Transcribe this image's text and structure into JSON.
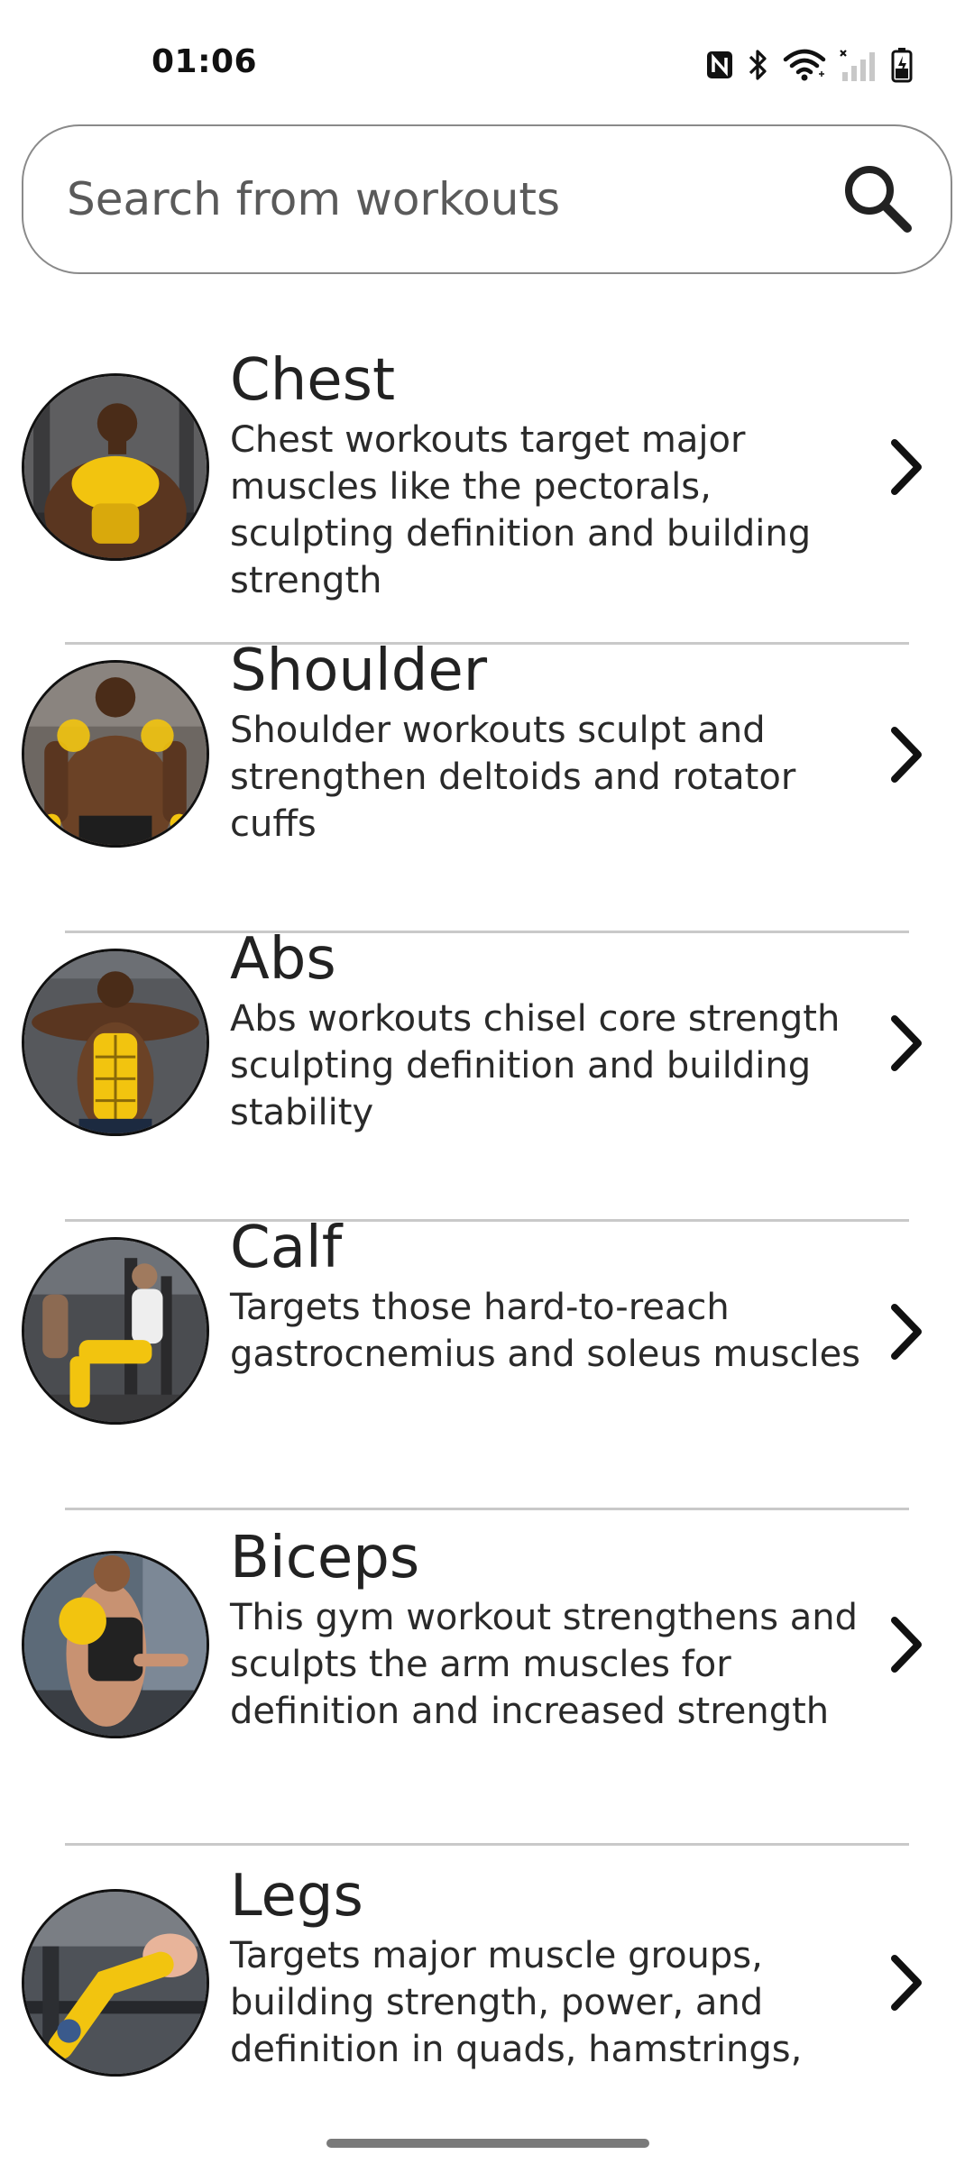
{
  "status_bar": {
    "time": "01:06",
    "icons": [
      "nfc-icon",
      "bluetooth-icon",
      "wifi-icon",
      "signal-icon",
      "battery-charging-icon"
    ]
  },
  "search": {
    "placeholder": "Search from workouts",
    "icon": "search-icon"
  },
  "workouts": [
    {
      "title": "Chest",
      "description": "Chest workouts target major muscles like the pectorals, sculpting definition and building strength",
      "image": "chest-workout-image",
      "icon": "chevron-right-icon"
    },
    {
      "title": "Shoulder",
      "description": "Shoulder workouts sculpt and strengthen deltoids and rotator cuffs",
      "image": "shoulder-workout-image",
      "icon": "chevron-right-icon"
    },
    {
      "title": "Abs",
      "description": "Abs workouts chisel core strength sculpting definition and building stability",
      "image": "abs-workout-image",
      "icon": "chevron-right-icon"
    },
    {
      "title": "Calf",
      "description": "Targets those hard-to-reach gastrocnemius and soleus muscles",
      "image": "calf-workout-image",
      "icon": "chevron-right-icon"
    },
    {
      "title": "Biceps",
      "description": "This gym workout strengthens and sculpts the arm muscles for definition and increased strength",
      "image": "biceps-workout-image",
      "icon": "chevron-right-icon"
    },
    {
      "title": "Legs",
      "description": "Targets major muscle groups, building strength, power, and definition in quads, hamstrings,",
      "image": "legs-workout-image",
      "icon": "chevron-right-icon"
    }
  ],
  "colors": {
    "highlight": "#f2c40f",
    "skin": "#6b4226",
    "text": "#1e1e1e",
    "divider": "#c9c9c9"
  }
}
